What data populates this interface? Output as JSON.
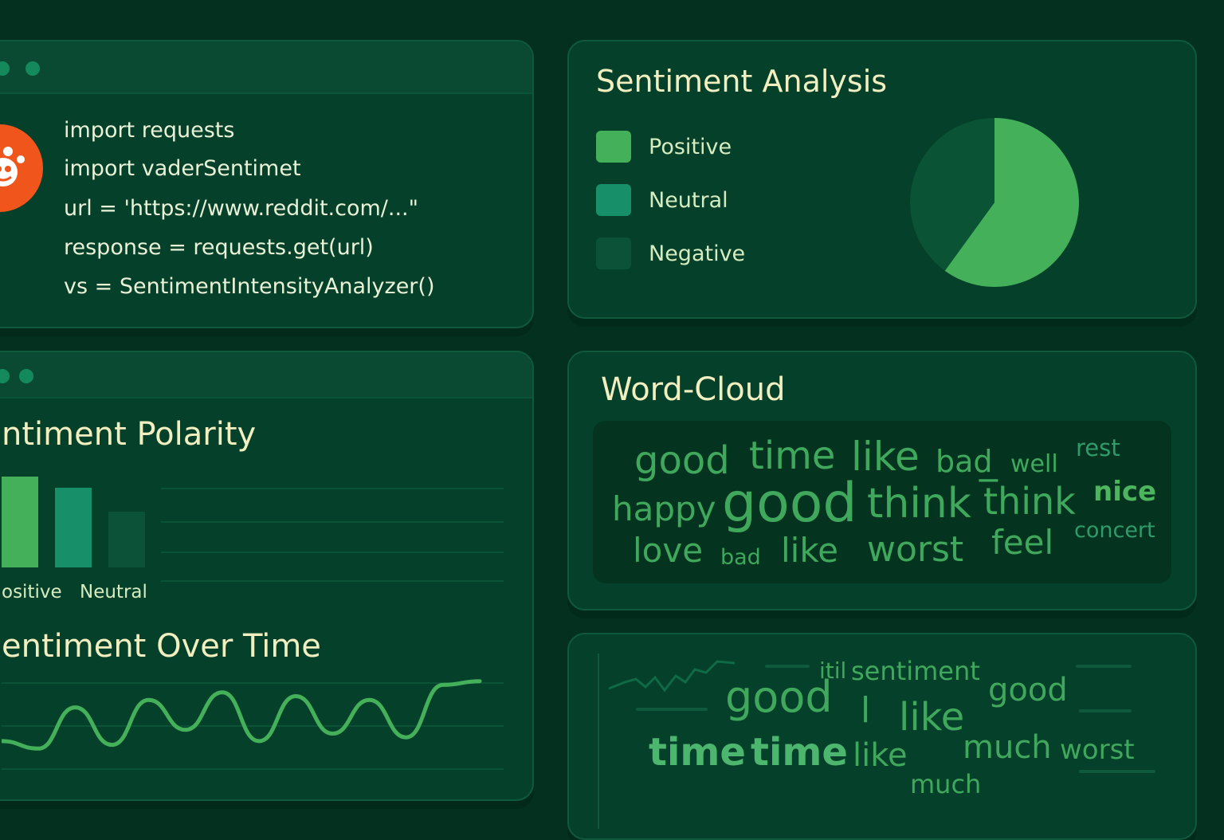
{
  "code_panel": {
    "lines": [
      "import requests",
      "import vaderSentimet",
      "url = 'https://www.reddit.com/...\"",
      "response = requests.get(url)",
      "vs = SentimentIntensityAnalyzer()"
    ]
  },
  "sentiment_panel": {
    "title": "Sentiment Analysis",
    "legend": [
      {
        "label": "Positive",
        "color": "#44b05a"
      },
      {
        "label": "Neutral",
        "color": "#17906a"
      },
      {
        "label": "Negative",
        "color": "#0b5238"
      }
    ]
  },
  "pie_chart": {
    "chart_data": {
      "type": "pie",
      "slices": [
        {
          "label": "Positive",
          "value": 60,
          "color": "#44b05a"
        },
        {
          "label": "Negative",
          "value": 40,
          "color": "#0a5335"
        }
      ]
    }
  },
  "polarity_panel": {
    "title": "ntiment Polarity",
    "chart_data": {
      "type": "bar",
      "categories": [
        "ositive",
        "Neutral",
        ""
      ],
      "values": [
        75,
        66,
        46
      ],
      "colors": [
        "#44b05a",
        "#17906a",
        "#0b5238"
      ],
      "ylim": [
        0,
        100
      ],
      "grid": true
    }
  },
  "over_time_panel": {
    "title": "entiment Over Time",
    "chart_data": {
      "type": "line",
      "color": "#44b05a",
      "values": [
        0.15,
        0.05,
        0.6,
        0.1,
        0.7,
        0.3,
        0.8,
        0.15,
        0.75,
        0.25,
        0.7,
        0.2,
        0.9,
        0.95
      ]
    }
  },
  "wordcloud_panel": {
    "title": "Word-Cloud",
    "words": [
      {
        "text": "good",
        "color": "#3fa85c"
      },
      {
        "text": "time",
        "color": "#3fa85c"
      },
      {
        "text": "like",
        "color": "#3fa85c"
      },
      {
        "text": "bad",
        "color": "#3fa85c"
      },
      {
        "text": "well",
        "color": "#3fa85c"
      },
      {
        "text": "rest",
        "color": "#2f9a6a"
      },
      {
        "text": "happy",
        "color": "#3fa85c"
      },
      {
        "text": "good",
        "color": "#3fa85c"
      },
      {
        "text": "think",
        "color": "#3fa85c"
      },
      {
        "text": "t̅hink",
        "color": "#3fa85c"
      },
      {
        "text": "nice",
        "color": "#4cb55e"
      },
      {
        "text": "concert",
        "color": "#2f9a6a"
      },
      {
        "text": "love",
        "color": "#3fa85c"
      },
      {
        "text": "bad",
        "color": "#3fa85c"
      },
      {
        "text": "like",
        "color": "#3fa85c"
      },
      {
        "text": "worst",
        "color": "#3fa85c"
      },
      {
        "text": "feel",
        "color": "#3fa85c"
      }
    ]
  },
  "bottom_panel": {
    "words": [
      {
        "text": "itil",
        "color": "#3fa85c"
      },
      {
        "text": "sentiment",
        "color": "#3fa85c"
      },
      {
        "text": "good",
        "color": "#3fa85c"
      },
      {
        "text": "good",
        "color": "#3fa85c"
      },
      {
        "text": "l",
        "color": "#3fa85c"
      },
      {
        "text": "like",
        "color": "#3fa85c"
      },
      {
        "text": "time",
        "color": "#4cb56e"
      },
      {
        "text": "time",
        "color": "#4cb56e"
      },
      {
        "text": "like",
        "color": "#3fa85c"
      },
      {
        "text": "much",
        "color": "#3fa85c"
      },
      {
        "text": "worst",
        "color": "#3fa85c"
      },
      {
        "text": "much",
        "color": "#3fa85c"
      }
    ]
  }
}
